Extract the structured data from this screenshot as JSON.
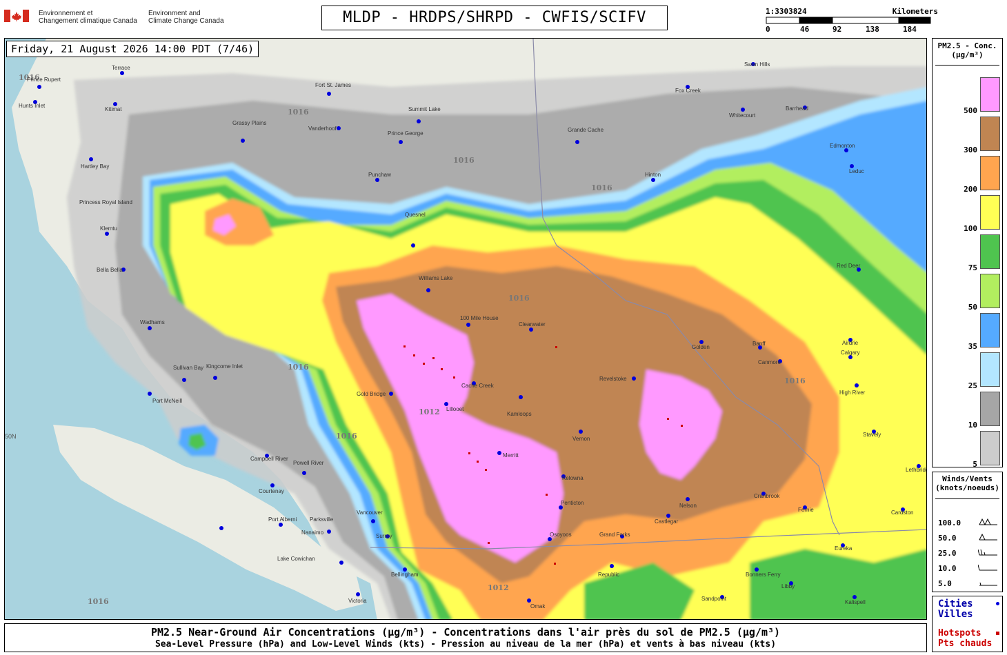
{
  "header": {
    "dept_fr_line1": "Environnement et",
    "dept_fr_line2": "Changement climatique Canada",
    "dept_en_line1": "Environment and",
    "dept_en_line2": "Climate Change Canada",
    "title": "MLDP - HRDPS/SHRPD - CWFIS/SCIFV"
  },
  "scale": {
    "ratio": "1:3303824",
    "unit": "Kilometers",
    "ticks": [
      "0",
      "46",
      "92",
      "138",
      "184"
    ]
  },
  "map": {
    "timestamp": "Friday, 21 August 2026 14:00 PDT (7/46)",
    "latitude_label": "50N",
    "isobar_labels": [
      "1016",
      "1012"
    ],
    "cities": [
      {
        "name": "Terrace"
      },
      {
        "name": "Prince Rupert"
      },
      {
        "name": "Kitimat"
      },
      {
        "name": "Hartley Bay"
      },
      {
        "name": "Princess Royal Island"
      },
      {
        "name": "Klemtu"
      },
      {
        "name": "Bella Bella"
      },
      {
        "name": "Hunts Inlet"
      },
      {
        "name": "Fort St. James"
      },
      {
        "name": "Grassy Plains"
      },
      {
        "name": "Vanderhoof"
      },
      {
        "name": "Prince George"
      },
      {
        "name": "Summit Lake"
      },
      {
        "name": "Punchaw"
      },
      {
        "name": "Quesnel"
      },
      {
        "name": "Williams Lake"
      },
      {
        "name": "100 Mile House"
      },
      {
        "name": "Clearwater"
      },
      {
        "name": "Kamloops"
      },
      {
        "name": "Revelstoke"
      },
      {
        "name": "Vernon"
      },
      {
        "name": "Kelowna"
      },
      {
        "name": "Penticton"
      },
      {
        "name": "Osoyoos"
      },
      {
        "name": "Grand Forks"
      },
      {
        "name": "Castlegar"
      },
      {
        "name": "Nelson"
      },
      {
        "name": "Cranbrook"
      },
      {
        "name": "Merritt"
      },
      {
        "name": "Lillooet"
      },
      {
        "name": "Gold Bridge"
      },
      {
        "name": "Cache Creek"
      },
      {
        "name": "Vancouver"
      },
      {
        "name": "Surrey"
      },
      {
        "name": "Bellingham"
      },
      {
        "name": "Victoria"
      },
      {
        "name": "Nanaimo"
      },
      {
        "name": "Parksville"
      },
      {
        "name": "Port Alberni"
      },
      {
        "name": "Courtenay"
      },
      {
        "name": "Campbell River"
      },
      {
        "name": "Powell River"
      },
      {
        "name": "Port McNeill"
      },
      {
        "name": "Sullivan Bay"
      },
      {
        "name": "Kingcome Inlet"
      },
      {
        "name": "Wadhams"
      },
      {
        "name": "Lake Cowichan"
      },
      {
        "name": "Hinton"
      },
      {
        "name": "Grande Cache"
      },
      {
        "name": "Edmonton"
      },
      {
        "name": "Leduc"
      },
      {
        "name": "Whitecourt"
      },
      {
        "name": "Fox Creek"
      },
      {
        "name": "Swan Hills"
      },
      {
        "name": "Barrhead"
      },
      {
        "name": "Red Deer"
      },
      {
        "name": "Calgary"
      },
      {
        "name": "Canmore"
      },
      {
        "name": "Banff"
      },
      {
        "name": "Golden"
      },
      {
        "name": "Airdrie"
      },
      {
        "name": "High River"
      },
      {
        "name": "Stavely"
      },
      {
        "name": "Lethbridge"
      },
      {
        "name": "Cardston"
      },
      {
        "name": "Fernie"
      },
      {
        "name": "Eureka"
      },
      {
        "name": "Libby"
      },
      {
        "name": "Kalispell"
      },
      {
        "name": "Republic"
      },
      {
        "name": "Sandpoint"
      },
      {
        "name": "Bonners Ferry"
      },
      {
        "name": "Omak"
      }
    ]
  },
  "legend": {
    "title_line1": "PM2.5 - Conc.",
    "title_line2": "(µg/m³)",
    "items": [
      {
        "label": "500",
        "color": "#ff99ff"
      },
      {
        "label": "300",
        "color": "#c08552"
      },
      {
        "label": "200",
        "color": "#ffa54f"
      },
      {
        "label": "100",
        "color": "#ffff55"
      },
      {
        "label": "75",
        "color": "#4fc44f"
      },
      {
        "label": "50",
        "color": "#b2ee5f"
      },
      {
        "label": "35",
        "color": "#55aaff"
      },
      {
        "label": "25",
        "color": "#b3e6ff"
      },
      {
        "label": "10",
        "color": "#a6a6a6"
      },
      {
        "label": "5",
        "color": "#cccccc"
      }
    ]
  },
  "winds": {
    "title_line1": "Winds/Vents",
    "title_line2": "(knots/noeuds)",
    "values": [
      "100.0",
      "50.0",
      "25.0",
      "10.0",
      "5.0"
    ]
  },
  "key": {
    "cities_en": "Cities",
    "cities_fr": "Villes",
    "hotspots_en": "Hotspots",
    "hotspots_fr": "Pts chauds",
    "city_color": "#0000dd",
    "hotspot_color": "#cc0000"
  },
  "footer": {
    "line1": "PM2.5 Near-Ground Air Concentrations (µg/m³) - Concentrations dans l'air près du sol de PM2.5 (µg/m³)",
    "line2": "Sea-Level Pressure (hPa) and Low-Level Winds (kts) - Pression au niveau de la mer (hPa) et vents à bas niveau (kts)"
  }
}
